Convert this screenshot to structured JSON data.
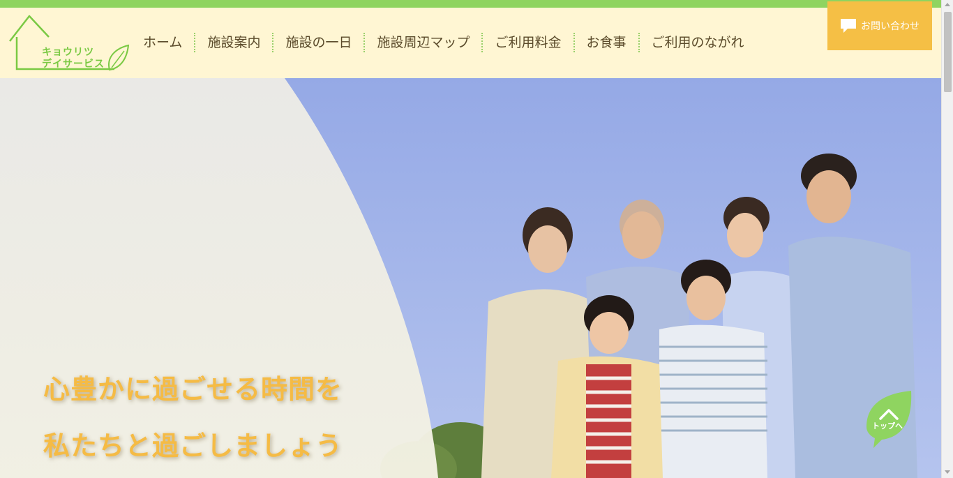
{
  "logo": {
    "line1": "キョウリツ",
    "line2": "デイサービス",
    "icon": "house-leaf-logo",
    "color": "#7ac943"
  },
  "nav": {
    "items": [
      {
        "label": "ホーム"
      },
      {
        "label": "施設案内"
      },
      {
        "label": "施設の一日"
      },
      {
        "label": "施設周辺マップ"
      },
      {
        "label": "ご利用料金"
      },
      {
        "label": "お食事"
      },
      {
        "label": "ご利用のながれ"
      }
    ]
  },
  "contact": {
    "label": "お問い合わせ",
    "icon": "speech-bubble-icon",
    "color": "#f5bf45"
  },
  "hero": {
    "headline_line1": "心豊かに過ごせる時間を",
    "headline_line2": "私たちと過ごしましょう",
    "image": "family-photo-outdoors",
    "headline_color": "#f5bb45"
  },
  "to_top": {
    "label": "トップへ",
    "icon": "chevron-up-icon",
    "color": "#8fd460"
  },
  "theme": {
    "accent_green": "#8fd460",
    "header_bg": "#fff6d3"
  }
}
